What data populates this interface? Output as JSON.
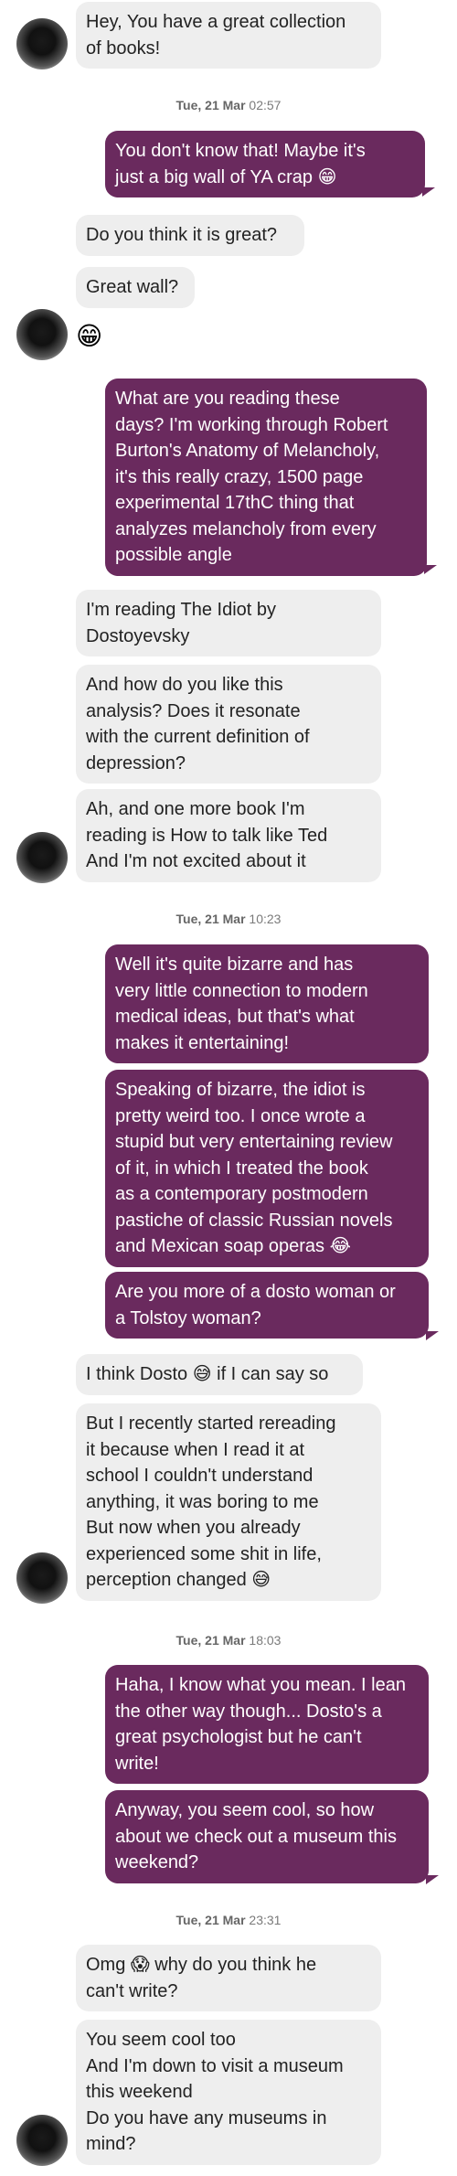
{
  "messages": [
    {
      "text": "Hey, You have a great collection\nof books!"
    },
    {
      "text": "You don't know that! Maybe it's\njust a big wall of YA crap 😁"
    },
    {
      "text": "Do you think it is great?"
    },
    {
      "text": "Great wall?"
    },
    {
      "text": "😁"
    },
    {
      "text": "What are you reading these\ndays? I'm working through Robert\nBurton's Anatomy of Melancholy,\nit's this really crazy, 1500 page\nexperimental 17thC thing that\nanalyzes melancholy from every\npossible angle"
    },
    {
      "text": "I'm reading The Idiot by\nDostoyevsky"
    },
    {
      "text": "And how do you like this\nanalysis? Does it resonate\nwith the current definition of\ndepression?"
    },
    {
      "text": "Ah, and one more book I'm\nreading is   How to talk like Ted\nAnd I'm not excited about it"
    },
    {
      "text": "Well it's quite bizarre and has\nvery little connection to modern\nmedical  ideas, but that's what\nmakes it entertaining!"
    },
    {
      "text": "Speaking of bizarre, the idiot is\npretty weird too. I once wrote a\nstupid but very entertaining review\nof it, in which I treated the book\nas a contemporary postmodern\npastiche of classic Russian novels\nand Mexican soap operas 😂"
    },
    {
      "text": "Are you more of a dosto woman or\na Tolstoy woman?"
    },
    {
      "text": "I think Dosto 😅 if I can say so"
    },
    {
      "text": "But I recently started rereading\nit because when I read it at\nschool I couldn't understand\nanything, it was boring to me\nBut now when you already\nexperienced some shit in life,\nperception changed 😅"
    },
    {
      "text": "Haha, I know what you mean. I lean\nthe other way though... Dosto's a\ngreat psychologist but he can't\nwrite!"
    },
    {
      "text": "Anyway, you seem cool, so how\nabout we check out a museum this\nweekend?"
    },
    {
      "text": "Omg 😱 why do you think he\ncan't write?"
    },
    {
      "text": "You seem cool too\nAnd I'm down to visit a museum\nthis weekend\nDo you have any museums in\nmind?"
    }
  ],
  "timestamps": [
    {
      "day": "Tue, 21 Mar",
      "time": "02:57"
    },
    {
      "day": "Tue, 21 Mar",
      "time": "10:23"
    },
    {
      "day": "Tue, 21 Mar",
      "time": "18:03"
    },
    {
      "day": "Tue, 21 Mar",
      "time": "23:31"
    }
  ],
  "colors": {
    "outgoing": "#6a2a5e",
    "incoming": "#eeeeee"
  }
}
